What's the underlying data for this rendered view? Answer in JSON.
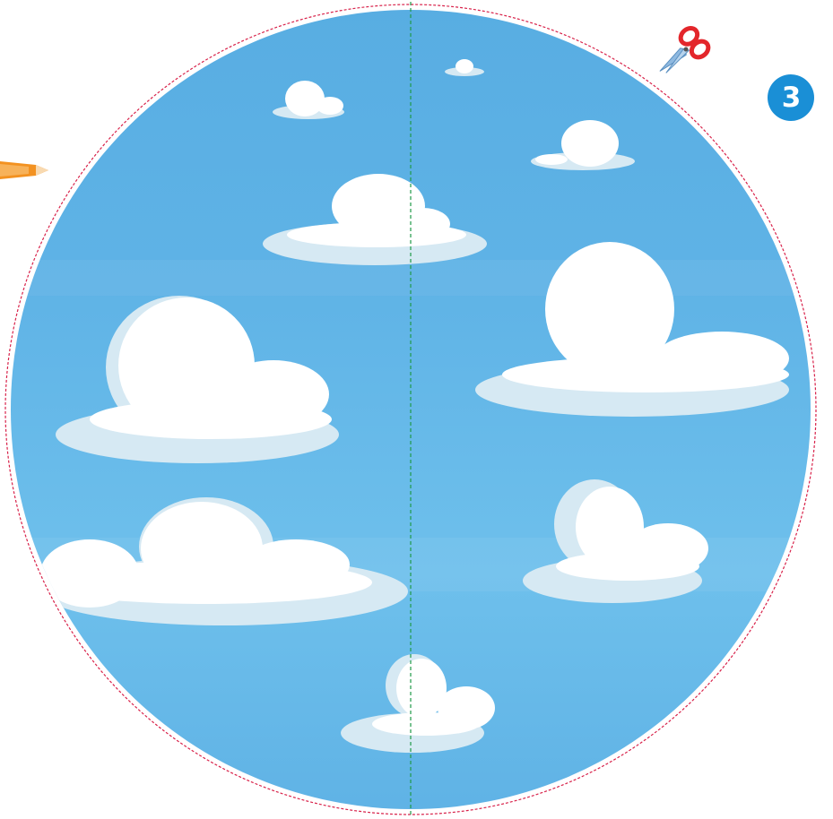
{
  "step_badge": {
    "label": "3",
    "color": "#1a8fd6"
  },
  "icons": {
    "scissors": "scissors-icon",
    "pencil": "pencil-tip-icon"
  },
  "colors": {
    "sky_top": "#5aafe3",
    "sky_bottom": "#6cbcea",
    "cloud_white": "#ffffff",
    "cloud_shade": "#d6e9f3",
    "cut_line": "#d8224a",
    "fold_line": "#1f9a48",
    "scissor_handle": "#e3262b",
    "scissor_blade": "#8fb9e0",
    "pencil_orange": "#f39221"
  }
}
